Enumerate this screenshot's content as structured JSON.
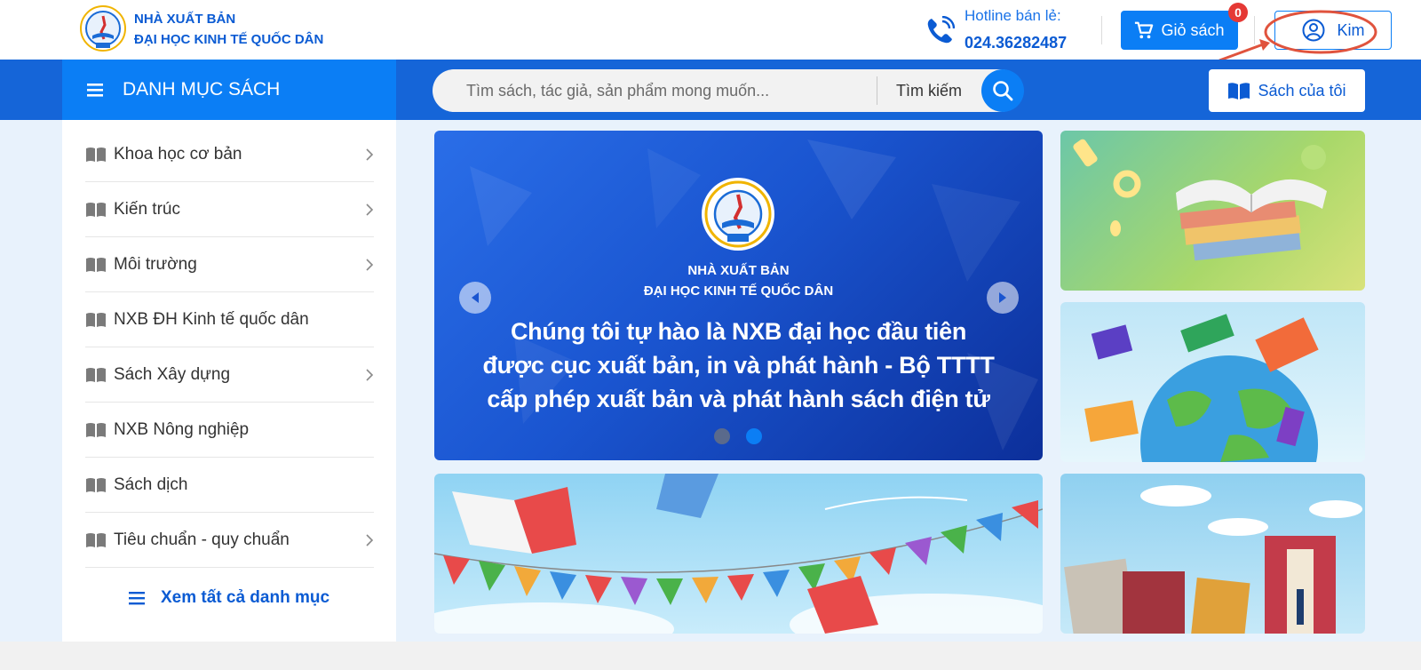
{
  "brand": {
    "line1": "NHÀ XUẤT BẢN",
    "line2": "ĐẠI HỌC KINH TẾ QUỐC DÂN"
  },
  "header": {
    "hotline_label": "Hotline bán lẻ:",
    "hotline_number": "024.36282487",
    "cart_label": "Giỏ sách",
    "cart_count": "0",
    "user_name": "Kim"
  },
  "nav": {
    "category_title": "DANH MỤC SÁCH",
    "search_placeholder": "Tìm sách, tác giả, sản phẩm mong muốn...",
    "search_label": "Tìm kiếm",
    "my_books_label": "Sách của tôi"
  },
  "categories": [
    {
      "label": "Khoa học cơ bản",
      "has_sub": true
    },
    {
      "label": "Kiến trúc",
      "has_sub": true
    },
    {
      "label": "Môi trường",
      "has_sub": true
    },
    {
      "label": "NXB ĐH Kinh tế quốc dân",
      "has_sub": false
    },
    {
      "label": "Sách Xây dựng",
      "has_sub": true
    },
    {
      "label": "NXB Nông nghiệp",
      "has_sub": false
    },
    {
      "label": "Sách dịch",
      "has_sub": false
    },
    {
      "label": "Tiêu chuẩn - quy chuẩn",
      "has_sub": true
    }
  ],
  "see_all_label": "Xem tất cả danh mục",
  "slider": {
    "publisher_line1": "NHÀ XUẤT BẢN",
    "publisher_line2": "ĐẠI HỌC KINH TẾ QUỐC DÂN",
    "message_line1": "Chúng tôi tự hào là NXB đại học đầu tiên",
    "message_line2": "được cục xuất bản, in và phát hành - Bộ TTTT",
    "message_line3": "cấp phép xuất bản và phát hành sách điện tử",
    "slide_count": 2,
    "active_slide": 2
  },
  "colors": {
    "primary": "#0b7ef5",
    "nav_band": "#1565d8",
    "brand_text": "#0b5bd3",
    "badge": "#e53935",
    "annotation": "#e0533d"
  },
  "icons": {
    "hotline": "phone-icon",
    "cart": "cart-icon",
    "user": "user-circle-icon",
    "menu": "hamburger-icon",
    "search": "search-icon",
    "my_books": "open-book-icon",
    "category": "book-icon",
    "chevron": "chevron-right-icon"
  }
}
